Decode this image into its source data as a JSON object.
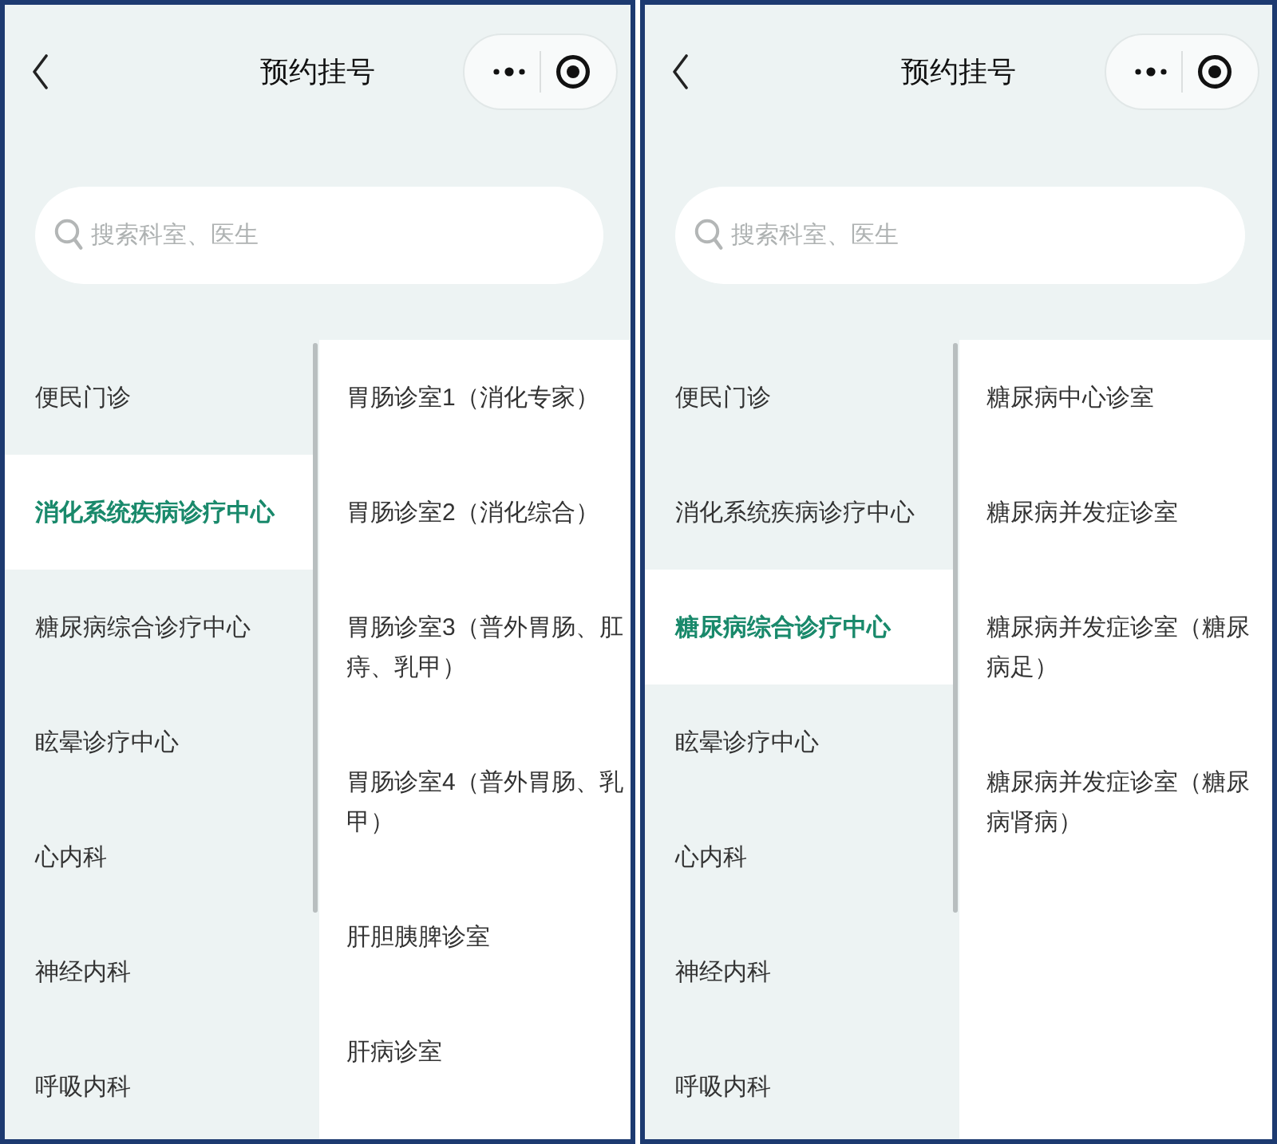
{
  "screens": [
    {
      "header": {
        "title": "预约挂号"
      },
      "search": {
        "placeholder": "搜索科室、医生"
      },
      "departments": [
        {
          "name": "便民门诊",
          "selected": false
        },
        {
          "name": "消化系统疾病诊疗中心",
          "selected": true
        },
        {
          "name": "糖尿病综合诊疗中心",
          "selected": false
        },
        {
          "name": "眩晕诊疗中心",
          "selected": false
        },
        {
          "name": "心内科",
          "selected": false
        },
        {
          "name": "神经内科",
          "selected": false
        },
        {
          "name": "呼吸内科",
          "selected": false
        }
      ],
      "clinics": [
        "胃肠诊室1（消化专家）",
        "胃肠诊室2（消化综合）",
        "胃肠诊室3（普外胃肠、肛痔、乳甲）",
        "胃肠诊室4（普外胃肠、乳甲）",
        "肝胆胰脾诊室",
        "肝病诊室"
      ]
    },
    {
      "header": {
        "title": "预约挂号"
      },
      "search": {
        "placeholder": "搜索科室、医生"
      },
      "departments": [
        {
          "name": "便民门诊",
          "selected": false
        },
        {
          "name": "消化系统疾病诊疗中心",
          "selected": false
        },
        {
          "name": "糖尿病综合诊疗中心",
          "selected": true
        },
        {
          "name": "眩晕诊疗中心",
          "selected": false
        },
        {
          "name": "心内科",
          "selected": false
        },
        {
          "name": "神经内科",
          "selected": false
        },
        {
          "name": "呼吸内科",
          "selected": false
        }
      ],
      "clinics": [
        "糖尿病中心诊室",
        "糖尿病并发症诊室",
        "糖尿病并发症诊室（糖尿病足）",
        "糖尿病并发症诊室（糖尿病肾病）"
      ]
    }
  ]
}
